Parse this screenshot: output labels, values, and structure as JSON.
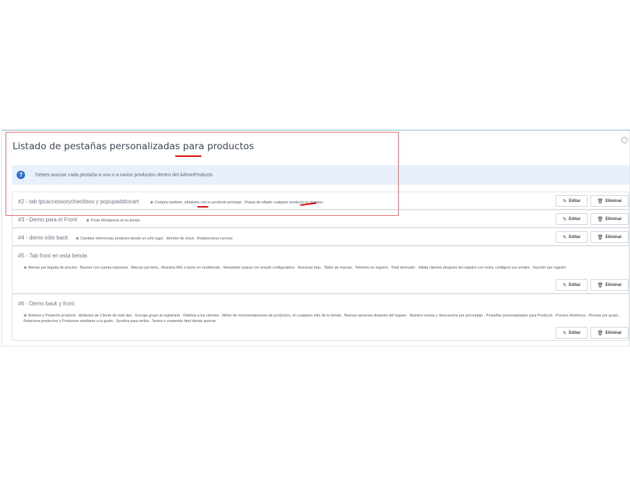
{
  "panel": {
    "title": "Listado de pestañas personalizadas para productos",
    "info": "Debes asociar cada pestaña a uno o a varios productos dentro del AdminProducts",
    "info_icon": "question-circle-icon",
    "accent_color": "#2a6fcf"
  },
  "tabs": [
    {
      "title": "#2 - tab tpcaccessorycheckbox y popupaddtocart",
      "tags": "Compra también, añadelos con tu producto principal . Popup de añadir cualquier producto en listados",
      "edit": "Editar",
      "delete": "Eliminar"
    },
    {
      "title": "#3 - Demo para el Front",
      "tags": "Posts Wordpress en tu tienda",
      "edit": "Editar",
      "delete": "Eliminar"
    },
    {
      "title": "#4 - demo sólo back",
      "tags": "Cambiar referencias producto desde un sólo lugar . Monitor de stock . Redirecciona correos",
      "edit": "Editar",
      "delete": "Eliminar"
    },
    {
      "title": "#5 - Tab front en esta tienda",
      "tags": "Alertas por bajada de precios . Banner con cuenta regresiva . Marcas por letra . Muestra IMG o looks en multitienda . Newsletter popup con emails configurables . Nuestras faqs . Slider de marcas . Telefono en registro . Total ahorrado . Valida clientes después del registro con extra, configura sus emails . Voucher por registro",
      "edit": "Editar",
      "delete": "Eliminar"
    },
    {
      "title": "#6 - Demo back y front",
      "tags": "Anterior y Posterior producto . Atributos de Cliente de todo tipo . Escoge grupo al registrarte . Fideliza a tus clientes . Motor de recomendaciones de productos, en cualquier sitio de tu tienda . Nuevas opciones después del logueo . Numero ventas y descuentos por porcentaje . Pestañas personalizadas para Producto . Precios Históricos . Precios por grupo . Relaciona productos o Productos similiares a tu gusto . Scrollea para arriba . Textos o contenido html donde quieras",
      "edit": "Editar",
      "delete": "Eliminar"
    }
  ],
  "icons": {
    "tag": "tag-icon",
    "edit": "pencil-square-icon",
    "delete": "trash-icon"
  },
  "annotation_color": "#e00000"
}
